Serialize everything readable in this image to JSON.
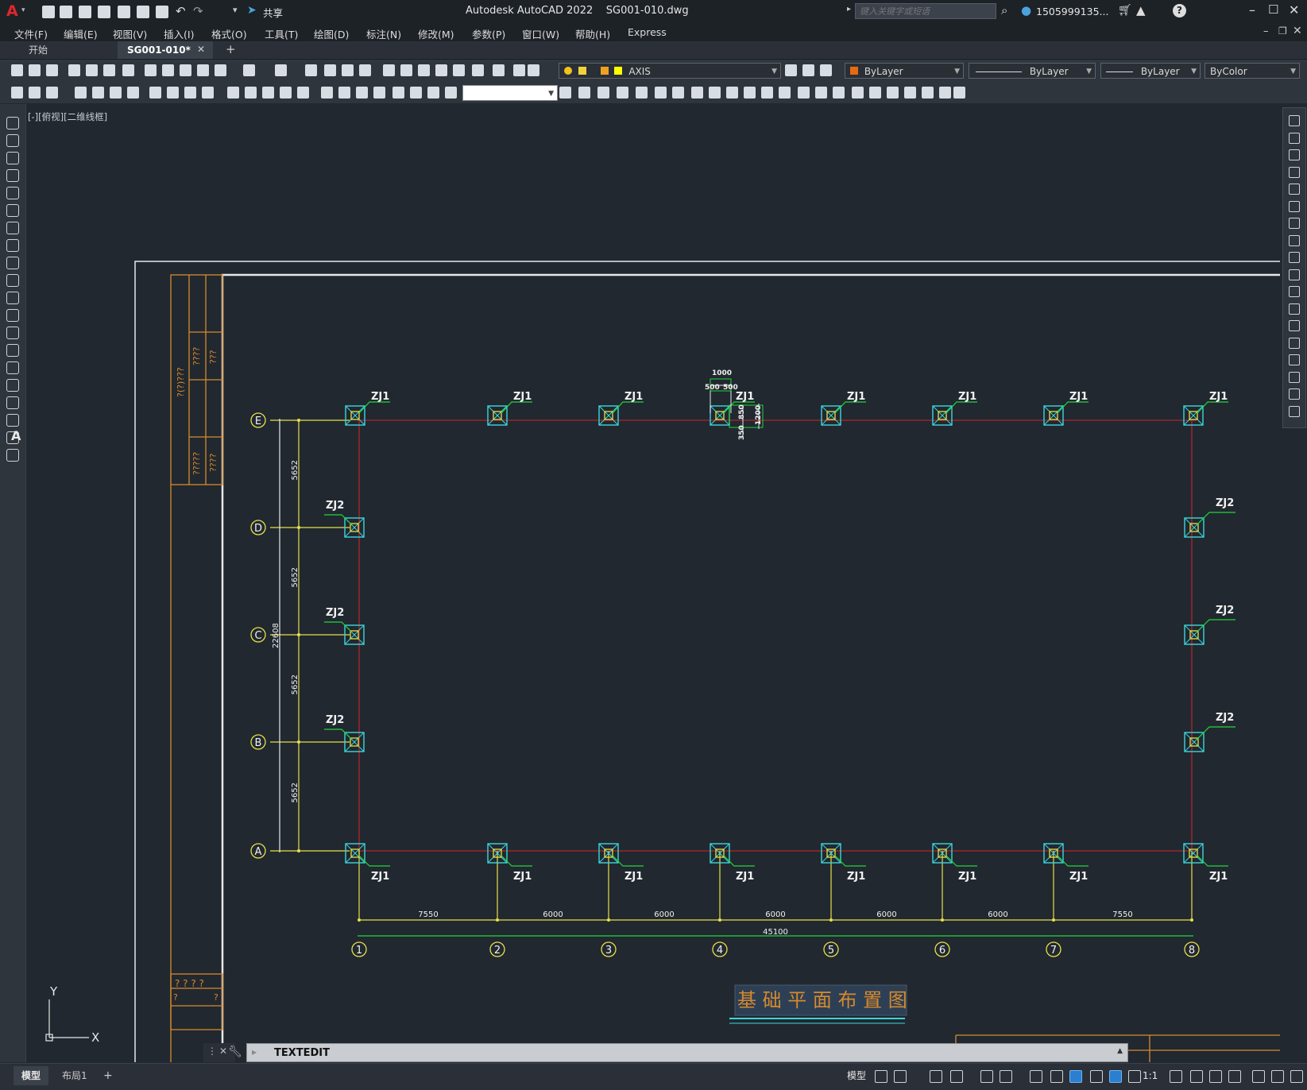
{
  "titlebar": {
    "app_letter": "A",
    "share_label": "共享",
    "title": "Autodesk AutoCAD 2022    SG001-010.dwg",
    "search_placeholder": "键入关键字或短语",
    "user": "1505999135...",
    "help": "?"
  },
  "menu": [
    "文件(F)",
    "编辑(E)",
    "视图(V)",
    "插入(I)",
    "格式(O)",
    "工具(T)",
    "绘图(D)",
    "标注(N)",
    "修改(M)",
    "参数(P)",
    "窗口(W)",
    "帮助(H)",
    "Express"
  ],
  "tabs": {
    "start": "开始",
    "active": "SG001-010*",
    "close": "✕",
    "add": "+"
  },
  "toolbar": {
    "layer_name": "AXIS",
    "color": "ByLayer",
    "linetype": "ByLayer",
    "lineweight": "ByLayer",
    "plotstyle": "ByColor"
  },
  "viewport_label": "[-][俯视][二维线框]",
  "drawing": {
    "title": "基 础 平 面 布 置 图",
    "row_axes": [
      "E",
      "D",
      "C",
      "B",
      "A"
    ],
    "col_axes": [
      "1",
      "2",
      "3",
      "4",
      "5",
      "6",
      "7",
      "8"
    ],
    "col_spacings": [
      "7550",
      "6000",
      "6000",
      "6000",
      "6000",
      "6000",
      "7550"
    ],
    "total_width": "45100",
    "row_spacings": [
      "5652",
      "5652",
      "5652",
      "5652"
    ],
    "total_height": "22608",
    "footing_labels": {
      "corner_edge": "ZJ1",
      "side": "ZJ2"
    },
    "detail_dims": {
      "top": "1000",
      "half_a": "500",
      "half_b": "500",
      "d1": "850",
      "d2": "1200",
      "d3": "350"
    },
    "titleblock_marks": {
      "a": "????",
      "b": "???",
      "c": "?(?)???",
      "d": "?????",
      "e": "????",
      "f": "? ? ? ?",
      "g": "?",
      "h": "?"
    },
    "ucs": {
      "y": "Y",
      "x": "X"
    }
  },
  "command": {
    "text": "TEXTEDIT"
  },
  "status": {
    "model": "模型",
    "layout1": "布局1",
    "add": "+",
    "model_btn": "模型",
    "scale": "1:1"
  },
  "colors": {
    "accent": "#2b9fd8",
    "grid_red": "#b0262a",
    "dim_yellow": "#e7e04a",
    "footing_cyan": "#3cd6dc",
    "leader_green": "#22d63a",
    "orange": "#d68a2a"
  }
}
